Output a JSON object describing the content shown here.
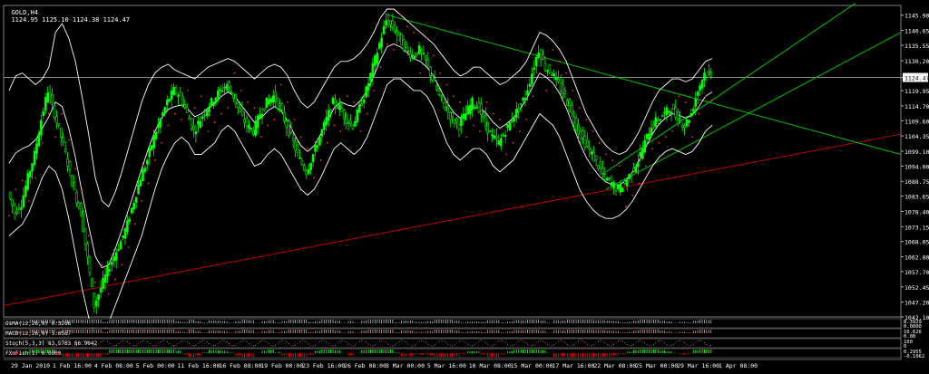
{
  "header": {
    "symbol_timeframe": "GOLD,H4",
    "ohlc": "1124.95 1125.10 1124.38 1124.47"
  },
  "current_price_label": "1124.47",
  "colors": {
    "background": "#000000",
    "bull_candle": "#00ff00",
    "bear_candle": "#00ff00",
    "bollinger": "#ffffff",
    "sar_dots": "#ff3030",
    "trend_red": "#c00000",
    "trend_green": "#00c000",
    "axis_text": "#ffffff"
  },
  "chart_data": [
    {
      "type": "candlestick",
      "title": "GOLD,H4",
      "y_ticks": [
        "1145.90",
        "1140.65",
        "1135.55",
        "1130.20",
        "1124.47",
        "1119.95",
        "1114.70",
        "1109.60",
        "1104.35",
        "1099.10",
        "1094.00",
        "1088.75",
        "1083.65",
        "1078.40",
        "1073.15",
        "1068.05",
        "1062.80",
        "1057.70",
        "1052.45",
        "1047.20",
        "1042.10"
      ],
      "ylim": [
        1042.1,
        1148.0
      ],
      "x_ticks": [
        "29 Jan 2010",
        "1 Feb 16:00",
        "4 Feb 08:00",
        "5 Feb 00:00",
        "11 Feb 16:00",
        "16 Feb 08:00",
        "19 Feb 00:00",
        "23 Feb 16:00",
        "26 Feb 08:00",
        "3 Mar 00:00",
        "5 Mar 16:00",
        "10 Mar 08:00",
        "15 Mar 00:00",
        "17 Mar 16:00",
        "22 Mar 08:00",
        "25 Mar 00:00",
        "29 Mar 16:00",
        "1 Apr 08:00"
      ],
      "close_path": [
        1085,
        1078,
        1081,
        1090,
        1098,
        1110,
        1120,
        1112,
        1104,
        1095,
        1085,
        1078,
        1062,
        1046,
        1052,
        1058,
        1063,
        1068,
        1074,
        1082,
        1090,
        1096,
        1104,
        1110,
        1116,
        1120,
        1118,
        1112,
        1106,
        1110,
        1114,
        1117,
        1120,
        1122,
        1118,
        1112,
        1108,
        1106,
        1112,
        1116,
        1118,
        1114,
        1108,
        1102,
        1096,
        1092,
        1098,
        1104,
        1110,
        1116,
        1114,
        1110,
        1108,
        1114,
        1120,
        1128,
        1136,
        1144,
        1142,
        1138,
        1134,
        1132,
        1134,
        1130,
        1124,
        1118,
        1114,
        1110,
        1108,
        1112,
        1116,
        1114,
        1108,
        1104,
        1102,
        1106,
        1110,
        1114,
        1118,
        1126,
        1134,
        1128,
        1126,
        1122,
        1118,
        1112,
        1106,
        1102,
        1098,
        1094,
        1090,
        1088,
        1086,
        1088,
        1092,
        1096,
        1102,
        1108,
        1110,
        1112,
        1114,
        1110,
        1108,
        1112,
        1120,
        1126,
        1124.47
      ],
      "bollinger_upper": [
        1120,
        1125,
        1126,
        1124,
        1122,
        1124,
        1128,
        1140,
        1143,
        1138,
        1130,
        1118,
        1105,
        1090,
        1082,
        1080,
        1085,
        1092,
        1100,
        1108,
        1116,
        1122,
        1126,
        1128,
        1129,
        1127,
        1126,
        1125,
        1124,
        1126,
        1128,
        1129,
        1130,
        1131,
        1130,
        1128,
        1126,
        1124,
        1126,
        1128,
        1129,
        1128,
        1125,
        1120,
        1116,
        1114,
        1116,
        1120,
        1124,
        1128,
        1130,
        1130,
        1131,
        1133,
        1136,
        1140,
        1145,
        1148,
        1148,
        1146,
        1144,
        1142,
        1140,
        1138,
        1136,
        1133,
        1130,
        1127,
        1125,
        1126,
        1128,
        1128,
        1126,
        1124,
        1122,
        1123,
        1125,
        1127,
        1130,
        1135,
        1140,
        1139,
        1137,
        1134,
        1130,
        1124,
        1118,
        1112,
        1108,
        1104,
        1101,
        1099,
        1098,
        1099,
        1102,
        1106,
        1111,
        1116,
        1120,
        1122,
        1124,
        1124,
        1123,
        1124,
        1127,
        1130,
        1131
      ],
      "bollinger_lower": [
        1070,
        1072,
        1074,
        1078,
        1084,
        1090,
        1094,
        1092,
        1086,
        1076,
        1064,
        1052,
        1042,
        1036,
        1036,
        1040,
        1046,
        1052,
        1058,
        1064,
        1070,
        1078,
        1086,
        1093,
        1098,
        1102,
        1104,
        1102,
        1098,
        1098,
        1100,
        1102,
        1106,
        1108,
        1106,
        1102,
        1098,
        1094,
        1095,
        1098,
        1100,
        1098,
        1094,
        1090,
        1086,
        1084,
        1086,
        1090,
        1095,
        1100,
        1102,
        1100,
        1098,
        1100,
        1104,
        1110,
        1116,
        1122,
        1124,
        1124,
        1122,
        1120,
        1120,
        1118,
        1114,
        1108,
        1102,
        1098,
        1096,
        1098,
        1100,
        1100,
        1098,
        1094,
        1092,
        1094,
        1096,
        1100,
        1104,
        1108,
        1112,
        1110,
        1108,
        1104,
        1098,
        1092,
        1086,
        1082,
        1079,
        1077,
        1076,
        1076,
        1077,
        1079,
        1082,
        1086,
        1090,
        1094,
        1097,
        1099,
        1100,
        1099,
        1098,
        1099,
        1102,
        1106,
        1108
      ],
      "indicators": [
        {
          "name": "OsMA(12,26,9)",
          "values": "0.3266"
        },
        {
          "name": "MACD(12,26,9)",
          "values": "5.6567"
        },
        {
          "name": "Stoch(5,3,3)",
          "values": "83.5763 86.9042"
        },
        {
          "name": "FXmFish(1)",
          "values": "0.0000"
        }
      ],
      "indicator_axis": [
        {
          "top": "8.3929",
          "bottom": "0.0000"
        },
        {
          "top": "10.626",
          "bottom": "0.00"
        },
        {
          "top": "100",
          "bottom": "0"
        },
        {
          "top": "0.2955",
          "bottom": "-0.1062"
        }
      ]
    }
  ]
}
